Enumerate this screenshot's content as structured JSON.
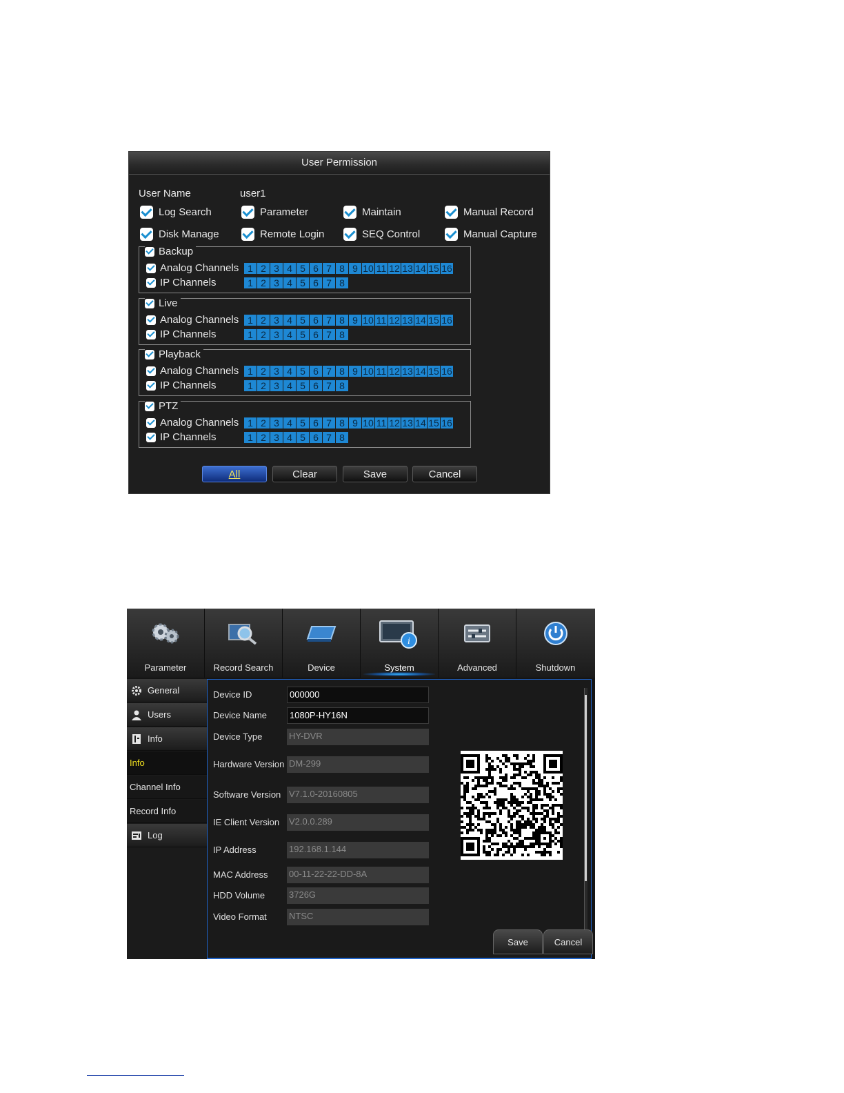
{
  "perm": {
    "title": "User Permission",
    "user_name_label": "User Name",
    "user_name_value": "user1",
    "rights": [
      "Log Search",
      "Parameter",
      "Maintain",
      "Manual Record",
      "Disk Manage",
      "Remote Login",
      "SEQ Control",
      "Manual Capture"
    ],
    "groups": [
      {
        "title": "Backup",
        "analog_label": "Analog Channels",
        "ip_label": "IP Channels"
      },
      {
        "title": "Live",
        "analog_label": "Analog Channels",
        "ip_label": "IP Channels"
      },
      {
        "title": "Playback",
        "analog_label": "Analog Channels",
        "ip_label": "IP Channels"
      },
      {
        "title": "PTZ",
        "analog_label": "Analog Channels",
        "ip_label": "IP Channels"
      }
    ],
    "analog_channels": [
      "1",
      "2",
      "3",
      "4",
      "5",
      "6",
      "7",
      "8",
      "9",
      "10",
      "11",
      "12",
      "13",
      "14",
      "15",
      "16"
    ],
    "ip_channels": [
      "1",
      "2",
      "3",
      "4",
      "5",
      "6",
      "7",
      "8"
    ],
    "buttons": {
      "all": "All",
      "clear": "Clear",
      "save": "Save",
      "cancel": "Cancel"
    },
    "checkbox_color": "#1a8fd0",
    "channel_color": "#1e88d4"
  },
  "system": {
    "nav": [
      {
        "label": "Parameter",
        "icon": "gears-icon"
      },
      {
        "label": "Record Search",
        "icon": "magnifier-icon"
      },
      {
        "label": "Device",
        "icon": "disk-icon"
      },
      {
        "label": "System",
        "icon": "monitor-info-icon",
        "active": true
      },
      {
        "label": "Advanced",
        "icon": "sliders-icon"
      },
      {
        "label": "Shutdown",
        "icon": "power-icon"
      }
    ],
    "sidebar": [
      {
        "label": "General",
        "icon": "gear-icon"
      },
      {
        "label": "Users",
        "icon": "user-icon"
      },
      {
        "label": "Info",
        "icon": "info-book-icon"
      },
      {
        "label": "Info",
        "sub": true,
        "selected": true
      },
      {
        "label": "Channel Info",
        "sub": true
      },
      {
        "label": "Record Info",
        "sub": true
      },
      {
        "label": "Log",
        "icon": "log-icon"
      }
    ],
    "fields": [
      {
        "label": "Device ID",
        "value": "000000",
        "editable": true
      },
      {
        "label": "Device Name",
        "value": "1080P-HY16N",
        "editable": true
      },
      {
        "label": "Device Type",
        "value": "HY-DVR"
      },
      {
        "label": "Hardware Version",
        "value": "DM-299"
      },
      {
        "label": "Software Version",
        "value": "V7.1.0-20160805"
      },
      {
        "label": "IE Client Version",
        "value": "V2.0.0.289"
      },
      {
        "label": "IP Address",
        "value": "192.168.1.144"
      },
      {
        "label": "MAC Address",
        "value": "00-11-22-22-DD-8A"
      },
      {
        "label": "HDD Volume",
        "value": "3726G"
      },
      {
        "label": "Video Format",
        "value": "NTSC"
      }
    ],
    "buttons": {
      "save": "Save",
      "cancel": "Cancel"
    },
    "accent_color": "#1f63c8",
    "selected_text_color": "#f0e020"
  }
}
